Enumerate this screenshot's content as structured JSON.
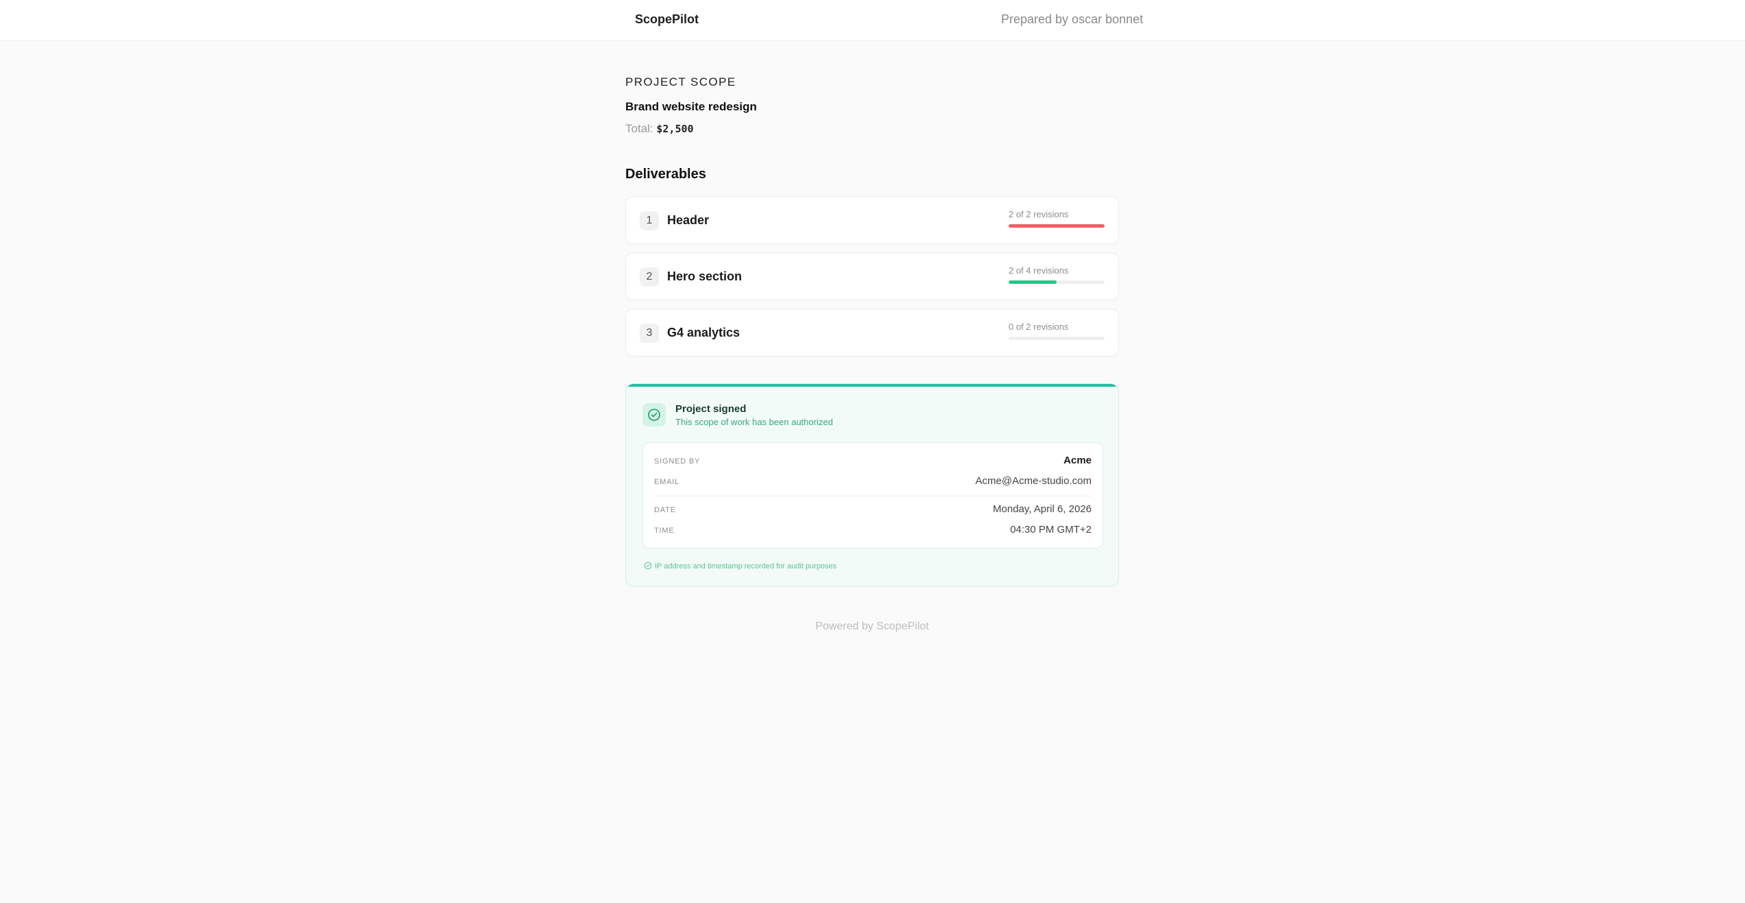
{
  "header": {
    "brand": "ScopePilot",
    "prepared_by": "Prepared by oscar bonnet"
  },
  "project": {
    "eyebrow": "PROJECT SCOPE",
    "title": "Brand website redesign",
    "total_label": "Total:",
    "total_value": "$2,500"
  },
  "deliverables": {
    "section_title": "Deliverables",
    "items": [
      {
        "number": "1",
        "name": "Header",
        "revisions_text": "2 of 2 revisions",
        "progress": 1.0,
        "color": "#f15e66"
      },
      {
        "number": "2",
        "name": "Hero section",
        "revisions_text": "2 of 4 revisions",
        "progress": 0.5,
        "color": "#1dc989"
      },
      {
        "number": "3",
        "name": "G4 analytics",
        "revisions_text": "0 of 2 revisions",
        "progress": 0.0,
        "color": "#1dc989"
      }
    ]
  },
  "signature": {
    "title": "Project signed",
    "subtitle": "This scope of work has been authorized",
    "signed_by_label": "SIGNED BY",
    "signed_by_value": "Acme",
    "email_label": "EMAIL",
    "email_value": "Acme@Acme-studio.com",
    "date_label": "DATE",
    "date_value": "Monday, April 6, 2026",
    "time_label": "TIME",
    "time_value": "04:30 PM GMT+2",
    "audit_note": "IP address and timestamp recorded for audit purposes",
    "accent_color": "#17c3a0"
  },
  "footer": {
    "powered_by": "Powered by ScopePilot"
  }
}
